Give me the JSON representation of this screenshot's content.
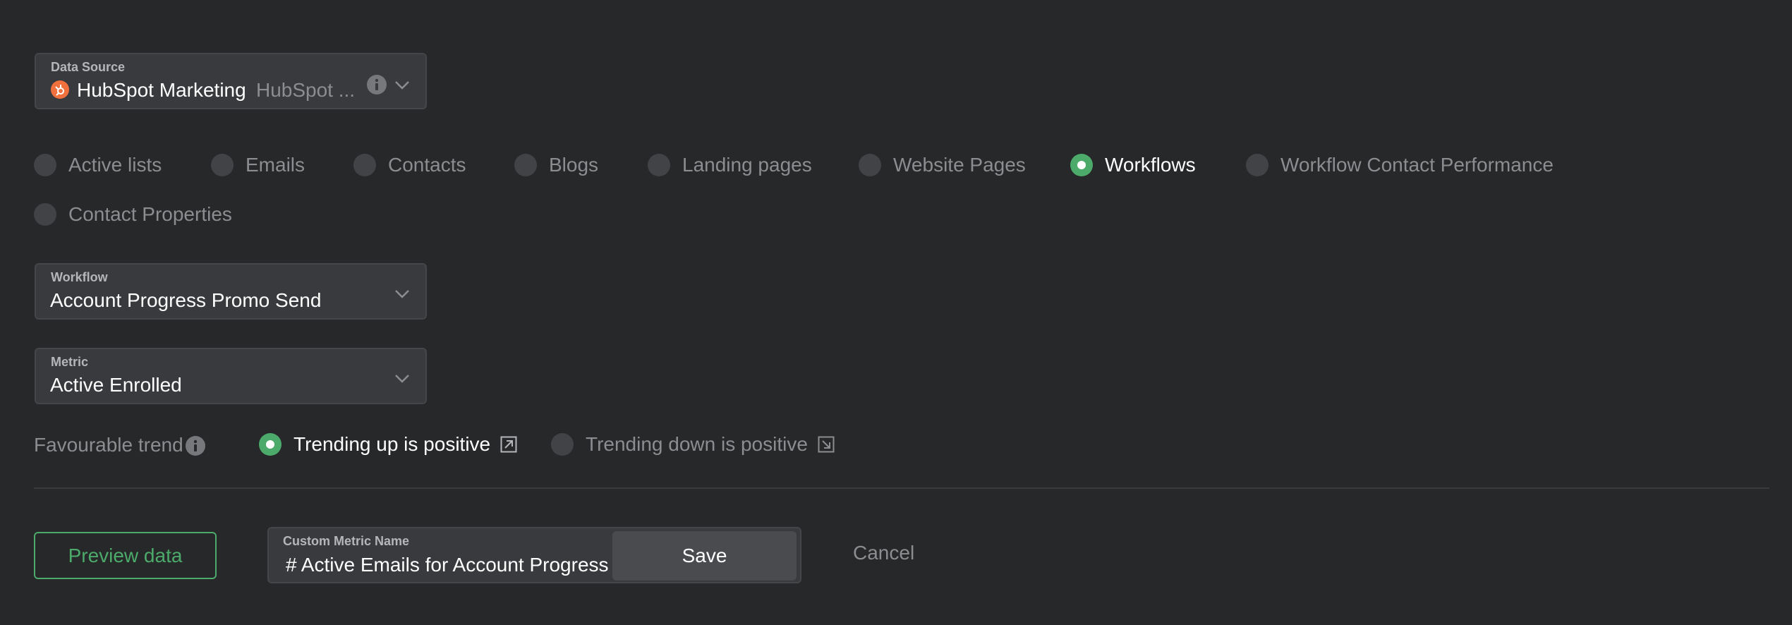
{
  "data_source": {
    "label": "Data Source",
    "name": "HubSpot Marketing",
    "account": "HubSpot ...",
    "brand_color": "#f0713d"
  },
  "report_types": [
    {
      "label": "Active lists",
      "selected": false
    },
    {
      "label": "Emails",
      "selected": false
    },
    {
      "label": "Contacts",
      "selected": false
    },
    {
      "label": "Blogs",
      "selected": false
    },
    {
      "label": "Landing pages",
      "selected": false
    },
    {
      "label": "Website Pages",
      "selected": false
    },
    {
      "label": "Workflows",
      "selected": true
    },
    {
      "label": "Workflow Contact Performance",
      "selected": false
    },
    {
      "label": "Contact Properties",
      "selected": false
    }
  ],
  "workflow": {
    "label": "Workflow",
    "value": "Account Progress Promo Send"
  },
  "metric": {
    "label": "Metric",
    "value": "Active Enrolled"
  },
  "trend": {
    "label": "Favourable trend",
    "options": [
      {
        "label": "Trending up is positive",
        "selected": true
      },
      {
        "label": "Trending down is positive",
        "selected": false
      }
    ]
  },
  "footer": {
    "preview_label": "Preview data",
    "custom_name_label": "Custom Metric Name",
    "custom_name_value": "# Active Emails for Account Progress Promo Send",
    "save_label": "Save",
    "cancel_label": "Cancel"
  },
  "colors": {
    "accent": "#4caa6a",
    "background": "#27282a"
  }
}
